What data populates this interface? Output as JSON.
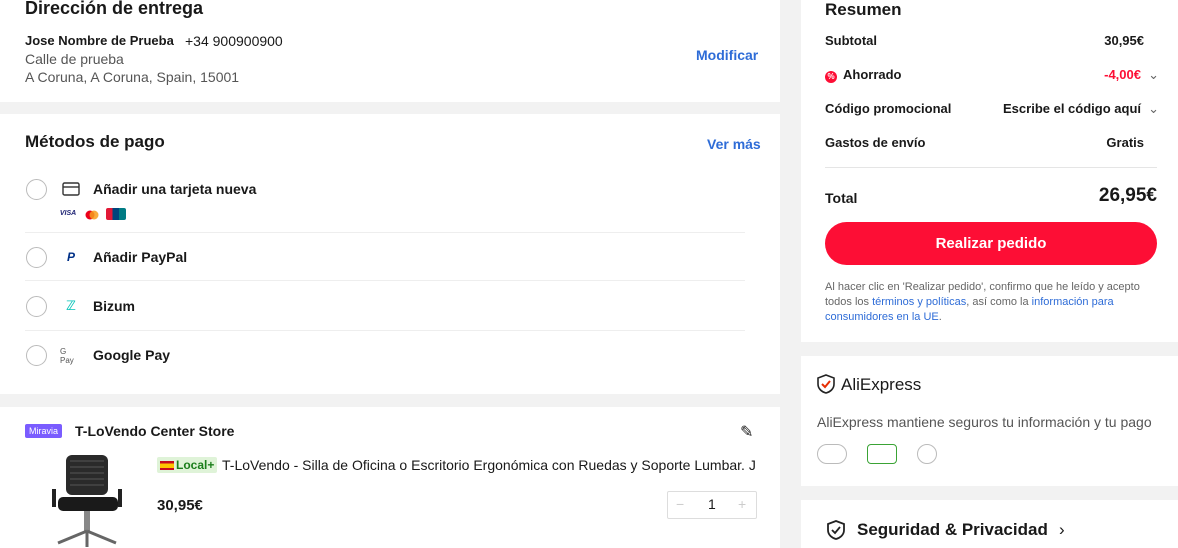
{
  "address": {
    "title": "Dirección de entrega",
    "name": "Jose Nombre de Prueba",
    "phone": "+34 900900900",
    "street": "Calle de prueba",
    "city": "A Coruna, A Coruna, Spain, 15001",
    "modify_label": "Modificar"
  },
  "payment": {
    "title": "Métodos de pago",
    "more_label": "Ver más",
    "methods": [
      {
        "label": "Añadir una tarjeta nueva",
        "icon": "credit-card-icon",
        "cards": [
          "VISA",
          "Mastercard",
          "UnionPay"
        ]
      },
      {
        "label": "Añadir PayPal",
        "icon": "paypal-icon"
      },
      {
        "label": "Bizum",
        "icon": "bizum-icon"
      },
      {
        "label": "Google Pay",
        "icon": "google-pay-icon",
        "icon_text": "G Pay"
      }
    ]
  },
  "store": {
    "badge": "Miravia",
    "name": "T-LoVendo Center Store",
    "product": {
      "local_tag": "Local+",
      "name": "T-LoVendo - Silla de Oficina o Escritorio Ergonómica con Ruedas y Soporte Lumbar. J",
      "price": "30,95€",
      "quantity": "1"
    }
  },
  "summary": {
    "title": "Resumen",
    "subtotal_label": "Subtotal",
    "subtotal_value": "30,95€",
    "saved_label": "Ahorrado",
    "saved_value": "-4,00€",
    "promo_label": "Código promocional",
    "promo_value": "Escribe el código aquí",
    "shipping_label": "Gastos de envío",
    "shipping_value": "Gratis",
    "total_label": "Total",
    "total_value": "26,95€",
    "order_button": "Realizar pedido",
    "legal_1": "Al hacer clic en 'Realizar pedido', confirmo que he leído y acepto todos los ",
    "legal_link_1": "términos y políticas",
    "legal_2": ", así como la ",
    "legal_link_2": "información para consumidores en la UE",
    "legal_3": ".",
    "accent_color": "#fd0e35",
    "saved_color": "#fd0e35"
  },
  "trust": {
    "title": "AliExpress",
    "description": "AliExpress mantiene seguros tu información y tu pago"
  },
  "security": {
    "title": "Seguridad & Privacidad"
  }
}
